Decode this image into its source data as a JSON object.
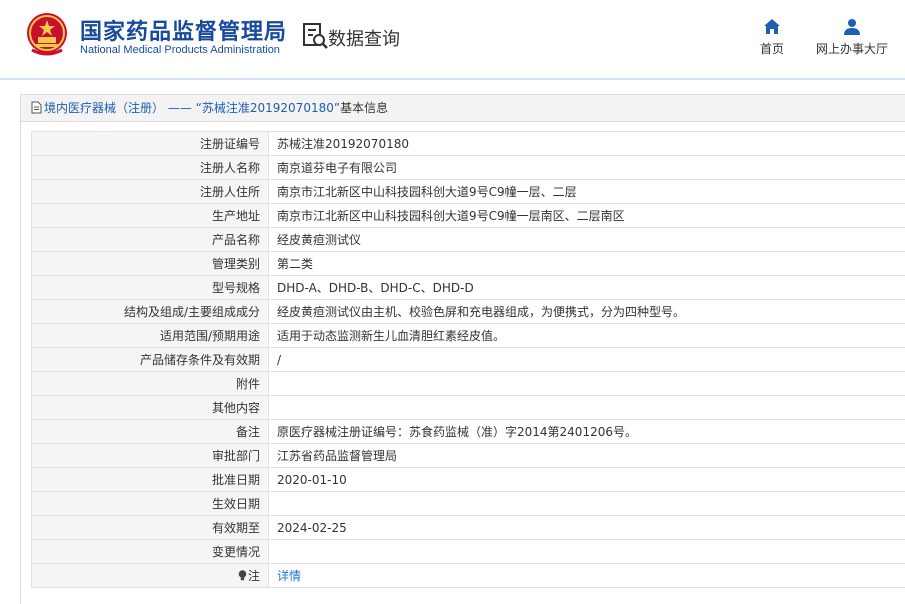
{
  "header": {
    "brand_cn": "国家药品监督管理局",
    "brand_en": "National Medical Products Administration",
    "query_label": "数据查询",
    "nav": [
      {
        "label": "首页",
        "icon": "home-icon"
      },
      {
        "label": "网上办事大厅",
        "icon": "user-icon"
      }
    ]
  },
  "breadcrumb": {
    "category": "境内医疗器械（注册）",
    "separator": " —— ",
    "record": "“苏械注准20192070180”",
    "suffix": "基本信息"
  },
  "details": [
    {
      "label": "注册证编号",
      "value": "苏械注准20192070180"
    },
    {
      "label": "注册人名称",
      "value": "南京道芬电子有限公司"
    },
    {
      "label": "注册人住所",
      "value": "南京市江北新区中山科技园科创大道9号C9幢一层、二层"
    },
    {
      "label": "生产地址",
      "value": "南京市江北新区中山科技园科创大道9号C9幢一层南区、二层南区"
    },
    {
      "label": "产品名称",
      "value": "经皮黄疸测试仪"
    },
    {
      "label": "管理类别",
      "value": "第二类"
    },
    {
      "label": "型号规格",
      "value": "DHD-A、DHD-B、DHD-C、DHD-D"
    },
    {
      "label": "结构及组成/主要组成成分",
      "value": "经皮黄疸测试仪由主机、校验色屏和充电器组成，为便携式，分为四种型号。"
    },
    {
      "label": "适用范围/预期用途",
      "value": "适用于动态监测新生儿血清胆红素经皮值。"
    },
    {
      "label": "产品储存条件及有效期",
      "value": "/"
    },
    {
      "label": "附件",
      "value": ""
    },
    {
      "label": "其他内容",
      "value": ""
    },
    {
      "label": "备注",
      "value": "原医疗器械注册证编号：苏食药监械（准）字2014第2401206号。"
    },
    {
      "label": "审批部门",
      "value": "江苏省药品监督管理局"
    },
    {
      "label": "批准日期",
      "value": "2020-01-10"
    },
    {
      "label": "生效日期",
      "value": ""
    },
    {
      "label": "有效期至",
      "value": "2024-02-25"
    },
    {
      "label": "变更情况",
      "value": ""
    }
  ],
  "note": {
    "label": "注",
    "link": "详情"
  }
}
